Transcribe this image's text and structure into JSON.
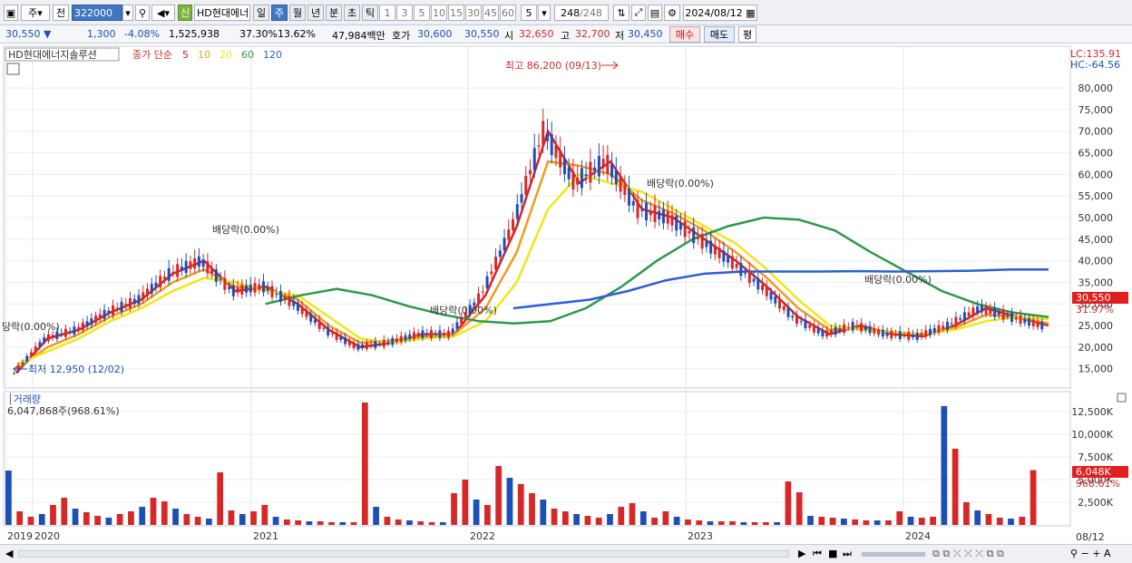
{
  "toolbar": {
    "period_mode": "주",
    "prev_label": "전",
    "code": "322000",
    "shin_label": "신",
    "stock_name": "HD현대에너",
    "tab_day": "일",
    "tab_week": "주",
    "tab_month": "월",
    "tab_year": "년",
    "tab_minute": "분",
    "tab_second": "초",
    "tab_tick": "틱",
    "intervals": [
      "1",
      "3",
      "5",
      "10",
      "15",
      "30",
      "45",
      "60"
    ],
    "interval_value": "5",
    "count": "248",
    "count_total": "/248",
    "date": "2024/08/12"
  },
  "quote": {
    "price": "30,550",
    "change": "1,300",
    "change_pct": "-4.08%",
    "volume": "1,525,938",
    "turnover_pct": "37.30%",
    "ratio": "13.62%",
    "amount": "47,984백만",
    "bid_label": "호가",
    "bid1": "30,600",
    "bid2": "30,550",
    "open_label": "시",
    "open": "32,650",
    "high_label": "고",
    "high": "32,700",
    "low_label": "저",
    "low": "30,450",
    "buy_label": "매수",
    "sell_label": "매도",
    "avg_label": "평"
  },
  "price_panel": {
    "name": "HD현대에너지솔루션",
    "ma_label": "종가 단순",
    "ma_periods": [
      "5",
      "10",
      "20",
      "60",
      "120"
    ],
    "lc": "LC:135.91",
    "hc": "HC:-64.56",
    "current_price": "30,550",
    "current_pct": "31.97%",
    "high_annotation": "최고 86,200 (09/13)",
    "low_annotation": "최저 12,950 (12/02)",
    "dividend_1": "당락(0.00%)",
    "dividend_2": "배당락(0.00%)",
    "dividend_3": "배당락(0.00%)",
    "dividend_4": "배당락(0.00%)",
    "dividend_5": "배당락(0.00%)"
  },
  "volume_panel": {
    "title": "거래량",
    "value": "6,047,868주(968.61%)",
    "current": "6,048K",
    "current_pct": "968.61%"
  },
  "bottom": {
    "date": "08/12"
  },
  "colors": {
    "up": "#d62828",
    "down": "#1d4fb8",
    "ma5": "#e0201f",
    "ma10": "#f29a1d",
    "ma20": "#f2e615",
    "ma60": "#2c9a4a",
    "ma120": "#2b5fd9"
  },
  "chart_data": [
    {
      "type": "line",
      "title": "HD현대에너지솔루션",
      "x": [
        "2019",
        "2020",
        "2021",
        "2022",
        "2023",
        "2024"
      ],
      "ylim": [
        12000,
        88000
      ],
      "yticks": [
        "15,000",
        "20,000",
        "25,000",
        "30,000",
        "35,000",
        "40,000",
        "45,000",
        "50,000",
        "55,000",
        "60,000",
        "65,000",
        "70,000",
        "75,000",
        "80,000"
      ],
      "series": [
        {
          "name": "5",
          "values": [
            14000,
            22000,
            24000,
            28000,
            31000,
            37000,
            40000,
            33000,
            34000,
            30000,
            24000,
            20000,
            21000,
            23000,
            23000,
            32000,
            48000,
            70000,
            58000,
            63000,
            52000,
            50000,
            45000,
            40000,
            34000,
            27000,
            23000,
            25000,
            23000,
            22500,
            25000,
            29000,
            27000,
            25000
          ]
        },
        {
          "name": "10",
          "values": [
            15000,
            20000,
            23000,
            27000,
            30000,
            35000,
            38000,
            34000,
            33500,
            31000,
            25000,
            21000,
            21500,
            22500,
            23000,
            29000,
            42000,
            63000,
            62000,
            60000,
            54000,
            51000,
            47000,
            42000,
            36000,
            29000,
            24000,
            24500,
            23500,
            23000,
            24500,
            27500,
            27000,
            25500
          ]
        },
        {
          "name": "20",
          "values": [
            16000,
            19000,
            22000,
            26000,
            29000,
            33000,
            36000,
            35000,
            33000,
            32000,
            27000,
            22000,
            21000,
            22000,
            22500,
            26000,
            35000,
            52000,
            60000,
            58000,
            56000,
            52000,
            48000,
            44000,
            38000,
            31000,
            25000,
            24000,
            23500,
            23000,
            24000,
            26000,
            27000,
            26500
          ]
        },
        {
          "name": "60",
          "values": [
            null,
            null,
            null,
            null,
            null,
            null,
            null,
            30000,
            32000,
            33500,
            32000,
            29500,
            27500,
            26000,
            25500,
            26000,
            29000,
            34000,
            40000,
            45000,
            48000,
            50000,
            49500,
            47000,
            42000,
            37500,
            33000,
            30000,
            28000,
            27000
          ]
        },
        {
          "name": "120",
          "values": [
            null,
            null,
            null,
            null,
            null,
            null,
            null,
            null,
            null,
            null,
            null,
            null,
            null,
            29000,
            30000,
            31000,
            33000,
            35500,
            37000,
            37500,
            37500,
            37500,
            37600,
            37500,
            37600,
            37700,
            38000,
            38000
          ]
        }
      ]
    },
    {
      "type": "bar",
      "title": "거래량",
      "yticks": [
        "2,500K",
        "5,000K",
        "7,500K",
        "10,000K",
        "12,500K"
      ],
      "ylim": [
        0,
        14000
      ],
      "values": [
        6000,
        1500,
        900,
        1200,
        2200,
        3000,
        1800,
        1400,
        1000,
        800,
        1200,
        1500,
        2000,
        3000,
        2600,
        1800,
        1200,
        900,
        700,
        5800,
        1600,
        1200,
        1500,
        2200,
        900,
        600,
        500,
        400,
        400,
        300,
        300,
        300,
        13500,
        2000,
        900,
        600,
        500,
        400,
        300,
        300,
        3500,
        5000,
        2800,
        2200,
        6500,
        5200,
        4500,
        3500,
        2800,
        1800,
        1500,
        1200,
        1000,
        800,
        1200,
        2000,
        2400,
        1500,
        800,
        1500,
        900,
        600,
        500,
        400,
        400,
        400,
        300,
        300,
        300,
        300,
        4800,
        3600,
        1000,
        900,
        800,
        700,
        600,
        500,
        500,
        500,
        1500,
        900,
        800,
        900,
        13100,
        8400,
        2500,
        1600,
        1200,
        800,
        700,
        900,
        6048
      ]
    }
  ]
}
